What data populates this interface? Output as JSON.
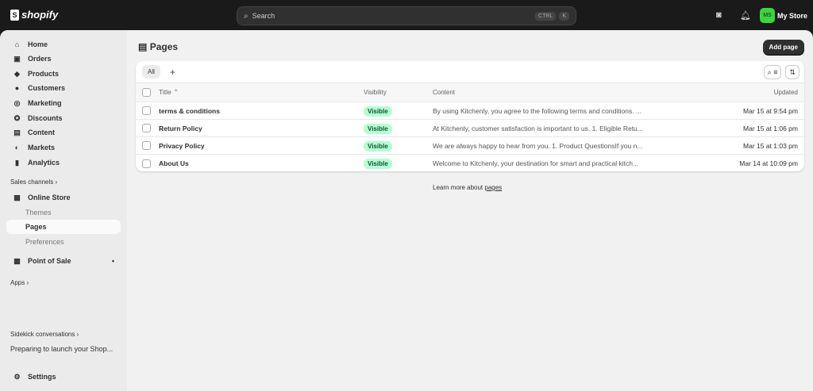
{
  "topbar": {
    "brand": "shopify",
    "search_placeholder": "Search",
    "shortcut": [
      "CTRL",
      "K"
    ],
    "store_initials": "MS",
    "store_name": "My Store",
    "avatar_color": "#3ad63a"
  },
  "sidebar": {
    "items": [
      {
        "label": "Home",
        "icon": "home-icon"
      },
      {
        "label": "Orders",
        "icon": "inbox-icon"
      },
      {
        "label": "Products",
        "icon": "tag-icon"
      },
      {
        "label": "Customers",
        "icon": "person-icon"
      },
      {
        "label": "Marketing",
        "icon": "target-icon"
      },
      {
        "label": "Discounts",
        "icon": "discount-icon"
      },
      {
        "label": "Content",
        "icon": "content-icon"
      },
      {
        "label": "Markets",
        "icon": "globe-icon"
      },
      {
        "label": "Analytics",
        "icon": "bar-chart-icon"
      }
    ],
    "sales_channels": "Sales channels",
    "online_store": "Online Store",
    "online_store_sub": [
      "Themes",
      "Pages",
      "Preferences"
    ],
    "point_of_sale": "Point of Sale",
    "apps": "Apps",
    "sidekick": "Sidekick conversations",
    "sidekick_item": "Preparing to launch your Shop...",
    "settings": "Settings"
  },
  "page": {
    "title": "Pages",
    "add_button": "Add page",
    "tabs": [
      "All"
    ],
    "columns": [
      "Title",
      "Visibility",
      "Content",
      "Updated"
    ],
    "rows": [
      {
        "title": "terms & conditions",
        "visibility": "Visible",
        "content": "By using Kitchenly, you agree to the following terms and conditions. ...",
        "updated": "Mar 15 at 9:54 pm"
      },
      {
        "title": "Return Policy",
        "visibility": "Visible",
        "content": "At Kitchenly, customer satisfaction is important to us. 1. Eligible Retu...",
        "updated": "Mar 15 at 1:06 pm"
      },
      {
        "title": "Privacy Policy",
        "visibility": "Visible",
        "content": "We are always happy to hear from you. 1. Product QuestionsIf you n...",
        "updated": "Mar 15 at 1:03 pm"
      },
      {
        "title": "About Us",
        "visibility": "Visible",
        "content": "Welcome to Kitchenly, your destination for smart and practical kitch...",
        "updated": "Mar 14 at 10:09 pm"
      }
    ],
    "learn_more": "Learn more about ",
    "learn_link": "pages"
  }
}
